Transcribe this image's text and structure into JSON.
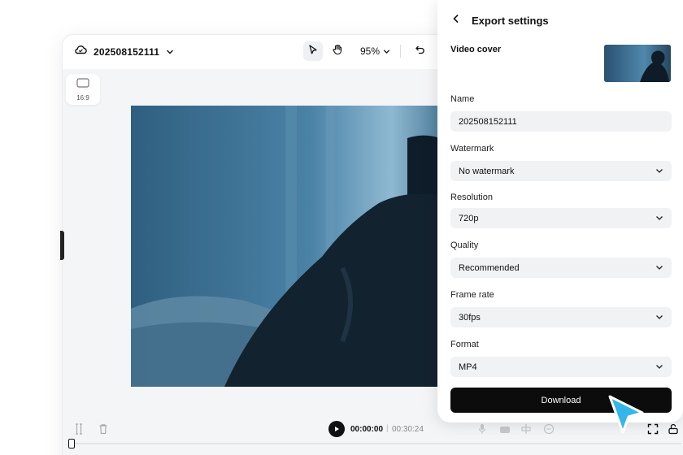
{
  "editor": {
    "project_name": "202508152111",
    "zoom_label": "95%",
    "ratio_label": "16:9"
  },
  "player": {
    "current_time": "00:00:00",
    "separator": "|",
    "total_time": "00:30:24"
  },
  "export_panel": {
    "title": "Export settings",
    "video_cover_label": "Video cover",
    "fields": {
      "name": {
        "label": "Name",
        "value": "202508152111"
      },
      "watermark": {
        "label": "Watermark",
        "value": "No watermark"
      },
      "resolution": {
        "label": "Resolution",
        "value": "720p"
      },
      "quality": {
        "label": "Quality",
        "value": "Recommended"
      },
      "frame_rate": {
        "label": "Frame rate",
        "value": "30fps"
      },
      "format": {
        "label": "Format",
        "value": "MP4"
      }
    },
    "download_label": "Download"
  },
  "colors": {
    "accent_cursor": "#35b6ea",
    "download_bg": "#0c0c0c",
    "field_bg": "#f1f2f4"
  }
}
